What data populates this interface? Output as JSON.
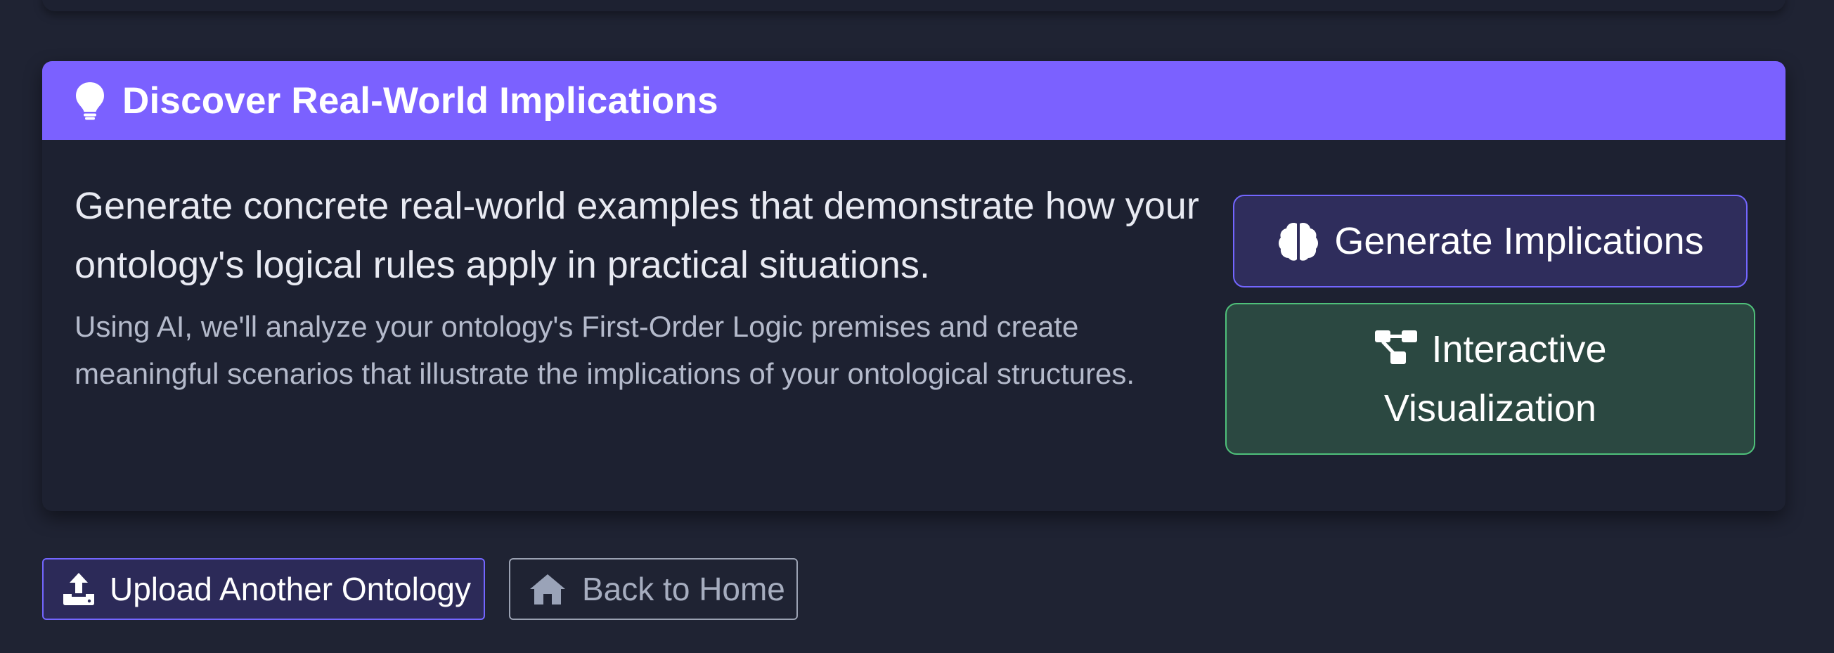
{
  "colors": {
    "background": "#1f2333",
    "card": "#1d2131",
    "header_accent": "#7b61ff",
    "primary_button_bg": "#2f2d5c",
    "primary_button_border": "#7366ff",
    "success_button_bg": "#2b4841",
    "success_button_border": "#4fc07a",
    "secondary_button_border": "#9aa1b2"
  },
  "implications_card": {
    "header_icon": "lightbulb-icon",
    "title": "Discover Real-World Implications",
    "lead": "Generate concrete real-world examples that demonstrate how your ontology's logical rules apply in practical situations.",
    "description": "Using AI, we'll analyze your ontology's First-Order Logic premises and create meaningful scenarios that illustrate the implications of your ontological structures.",
    "generate_button": {
      "icon": "brain-icon",
      "label": "Generate Implications"
    },
    "visualization_button": {
      "icon": "diagram-project-icon",
      "label_line1": "Interactive",
      "label_line2": "Visualization"
    }
  },
  "actions": {
    "upload_button": {
      "icon": "upload-icon",
      "label": "Upload Another Ontology"
    },
    "home_button": {
      "icon": "home-icon",
      "label": "Back to Home"
    }
  }
}
